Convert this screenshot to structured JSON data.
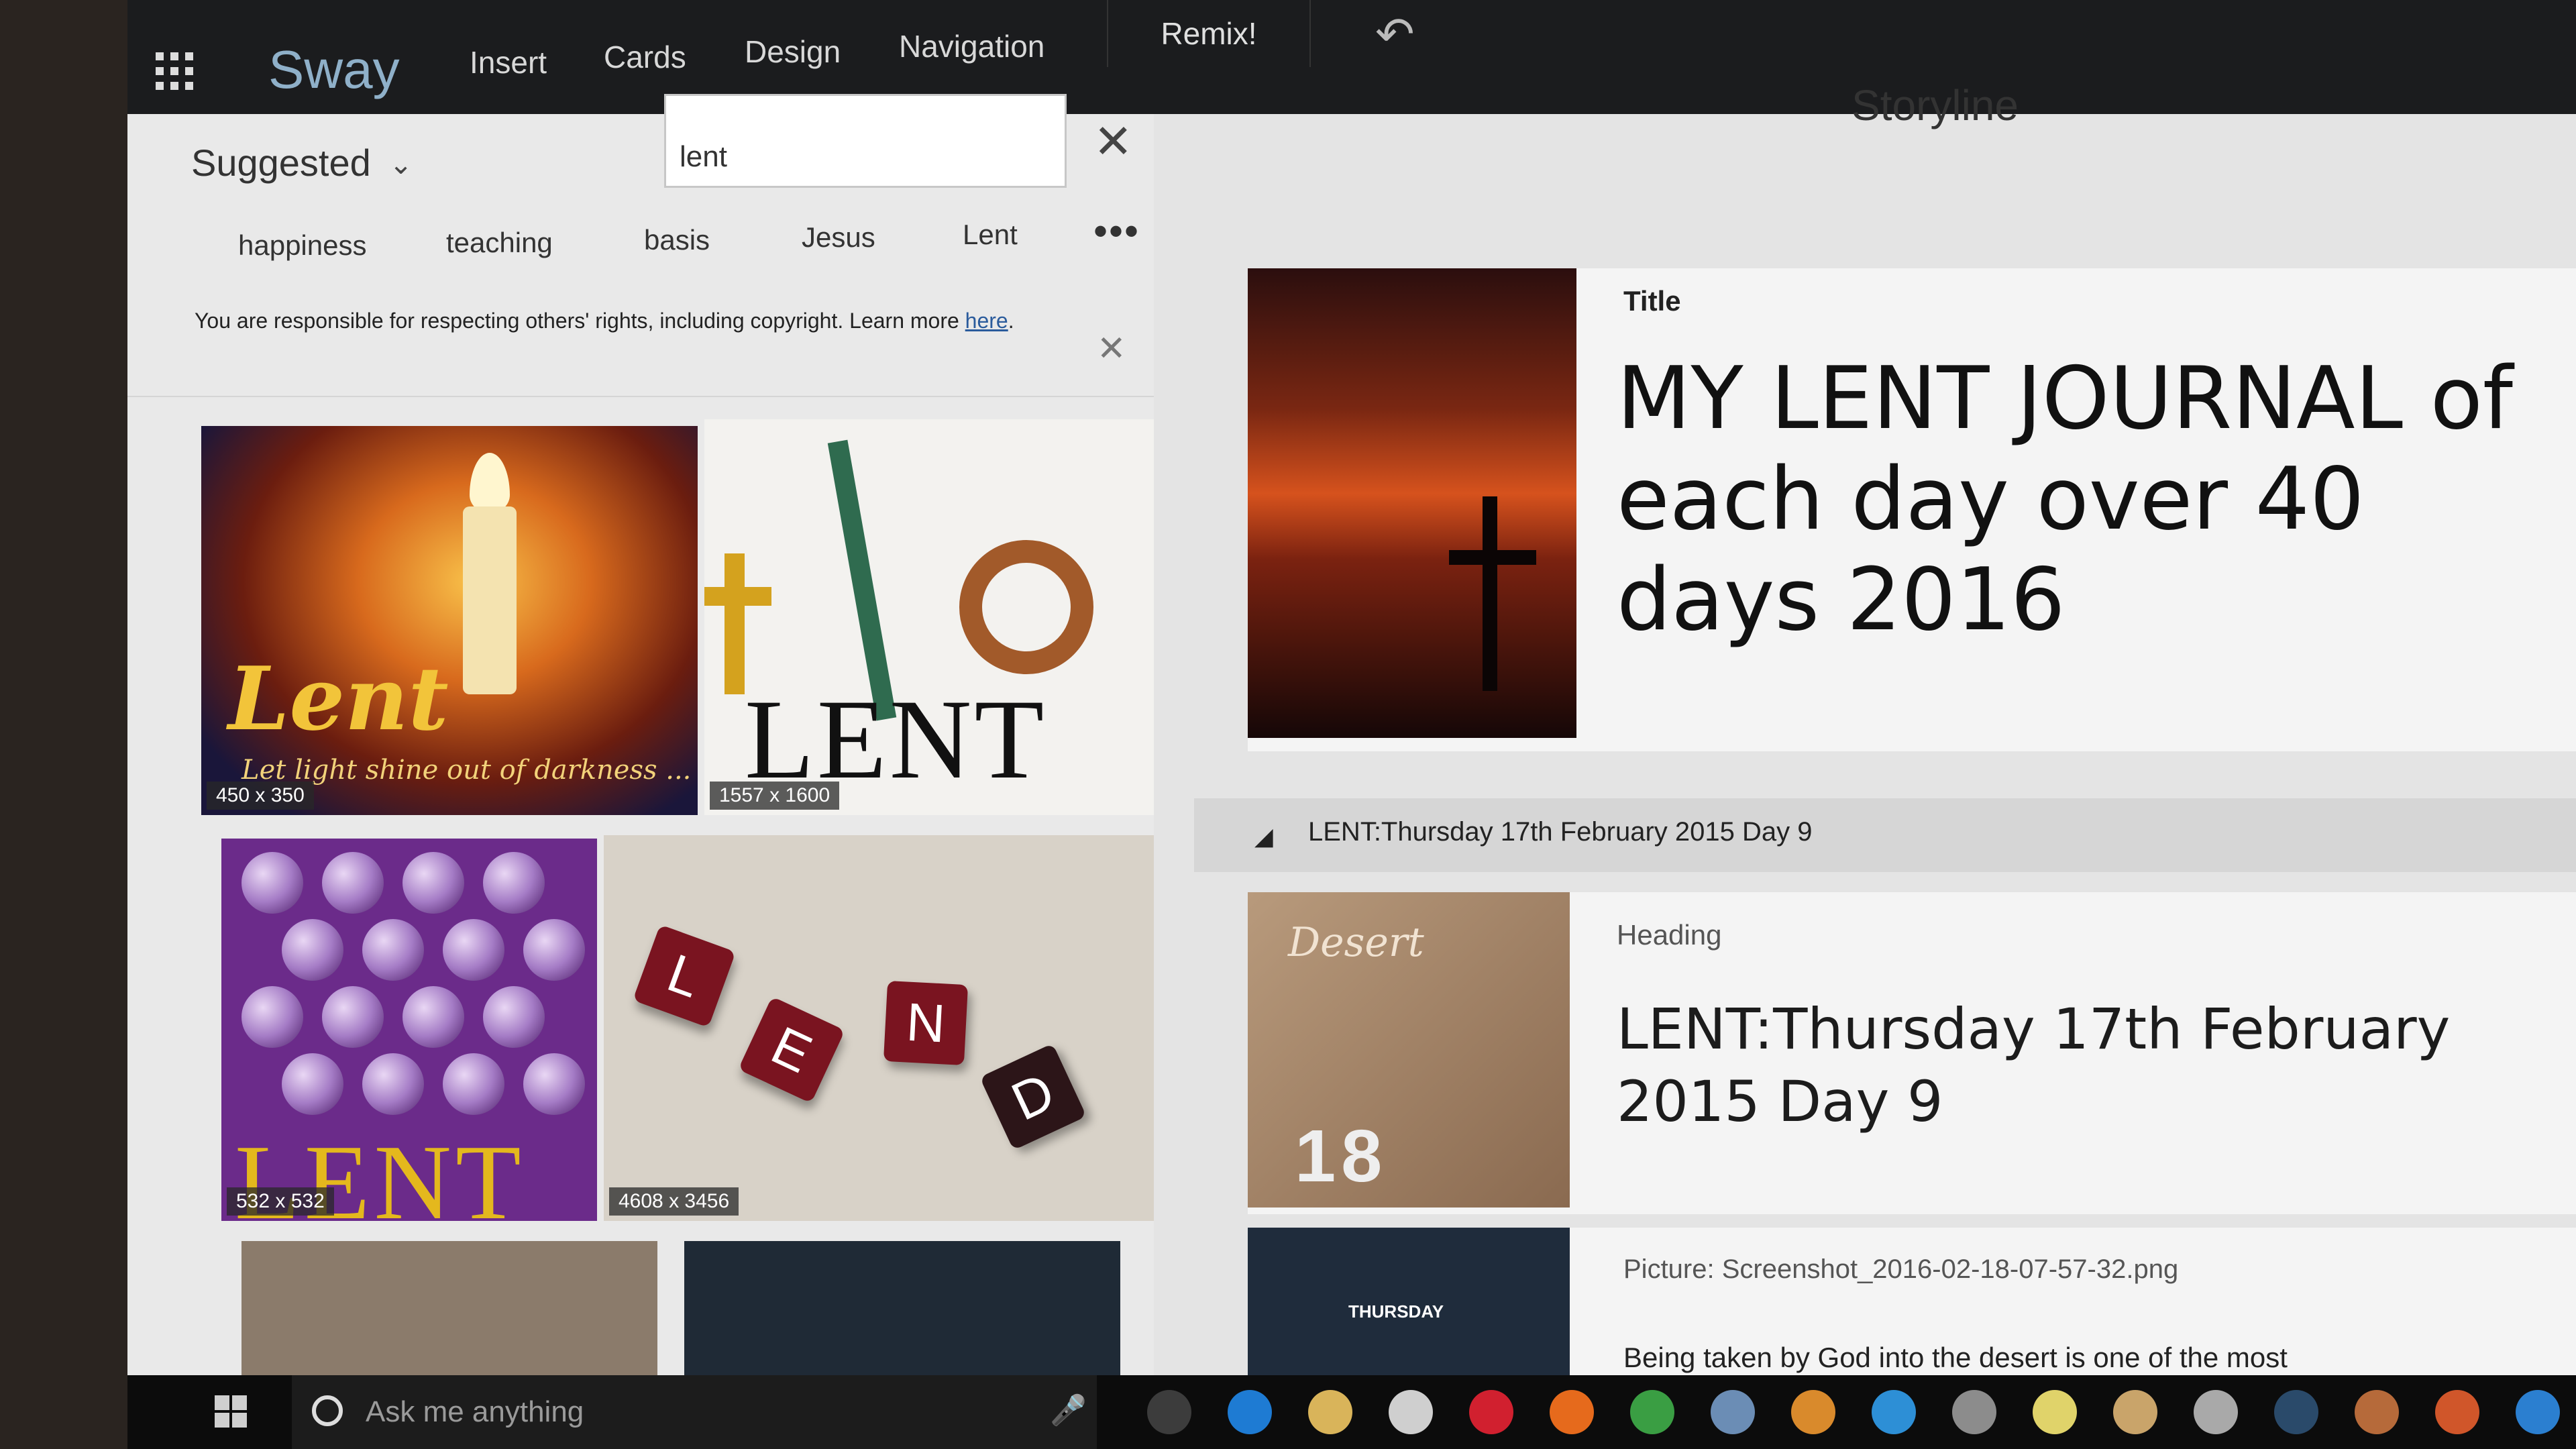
{
  "ribbon": {
    "brand": "Sway",
    "tabs": [
      "Insert",
      "Cards",
      "Design",
      "Navigation"
    ],
    "remix": "Remix!"
  },
  "search": {
    "filter_label": "Suggested",
    "query": "lent",
    "chips": [
      "happiness",
      "teaching",
      "basis",
      "Jesus",
      "Lent"
    ],
    "notice_text": "You are responsible for respecting others' rights, including copyright. Learn more ",
    "notice_link": "here"
  },
  "results": [
    {
      "overlay_word": "Lent",
      "overlay_sub": "Let light shine out of darkness ...",
      "dims": "450 x 350"
    },
    {
      "overlay_word": "LENT",
      "dims": "1557 x 1600"
    },
    {
      "overlay_word": "LENT",
      "dims": "532 x 532"
    },
    {
      "tiles": [
        "L",
        "E",
        "N",
        "D"
      ],
      "dims": "4608 x 3456"
    }
  ],
  "storyline": {
    "title": "Storyline",
    "card_title": {
      "label": "Title",
      "text": "MY LENT JOURNAL of each day over 40 days 2016"
    },
    "section": "LENT:Thursday 17th February 2015 Day 9",
    "card_heading": {
      "label": "Heading",
      "text": "LENT:Thursday 17th February 2015 Day 9",
      "thumb_text": "Desert",
      "thumb_num": "18"
    },
    "card_picture": {
      "caption": "Picture: Screenshot_2016-02-18-07-57-32.png",
      "thumb_text": "THURSDAY",
      "body": "Being taken by God into the desert is one of the most"
    }
  },
  "taskbar": {
    "search_placeholder": "Ask me anything"
  },
  "colors": {
    "ribbon_bg": "#1b1c1e",
    "brand": "#8fb0c9",
    "panel_bg": "#e9e9e9",
    "taskbar_bg": "#0c0c0c"
  },
  "icons": [
    "apps-grid-icon",
    "undo-icon",
    "chevron-down-icon",
    "close-icon",
    "more-icon",
    "windows-start-icon",
    "cortana-icon",
    "microphone-icon",
    "collapse-triangle-icon"
  ]
}
